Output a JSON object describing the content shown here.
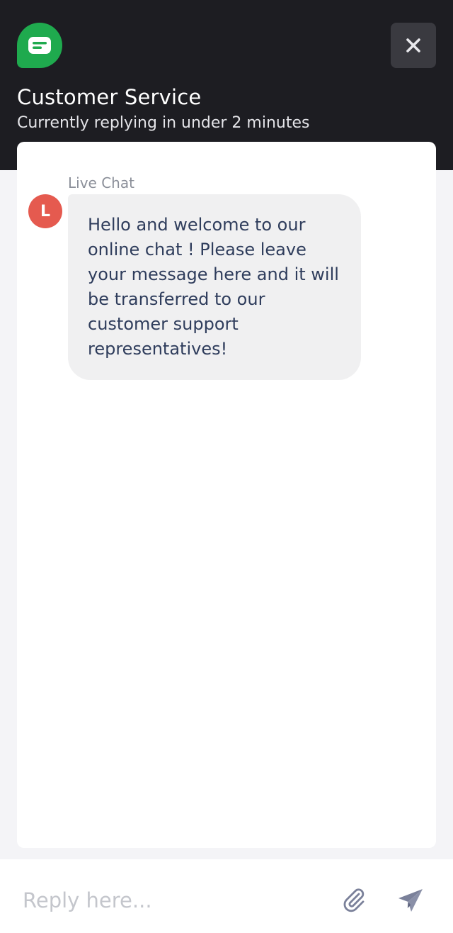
{
  "header": {
    "title": "Customer Service",
    "subtitle": "Currently replying in under 2 minutes",
    "logo_icon": "chat-bubble-icon",
    "close_icon": "close-icon"
  },
  "conversation": {
    "messages": [
      {
        "sender": "Live Chat",
        "avatar_initial": "L",
        "text": "Hello and welcome to our online chat ! Please leave your message here and it will be transferred to our customer support representatives!"
      }
    ]
  },
  "composer": {
    "placeholder": "Reply here...",
    "attach_icon": "paperclip-icon",
    "send_icon": "send-icon"
  },
  "colors": {
    "header_bg": "#1d1d22",
    "brand_green": "#1faa4e",
    "avatar_red": "#e55a4f",
    "bubble_bg": "#f0f0f1",
    "message_text": "#2f3d5c",
    "icon_gray": "#7b819a"
  }
}
